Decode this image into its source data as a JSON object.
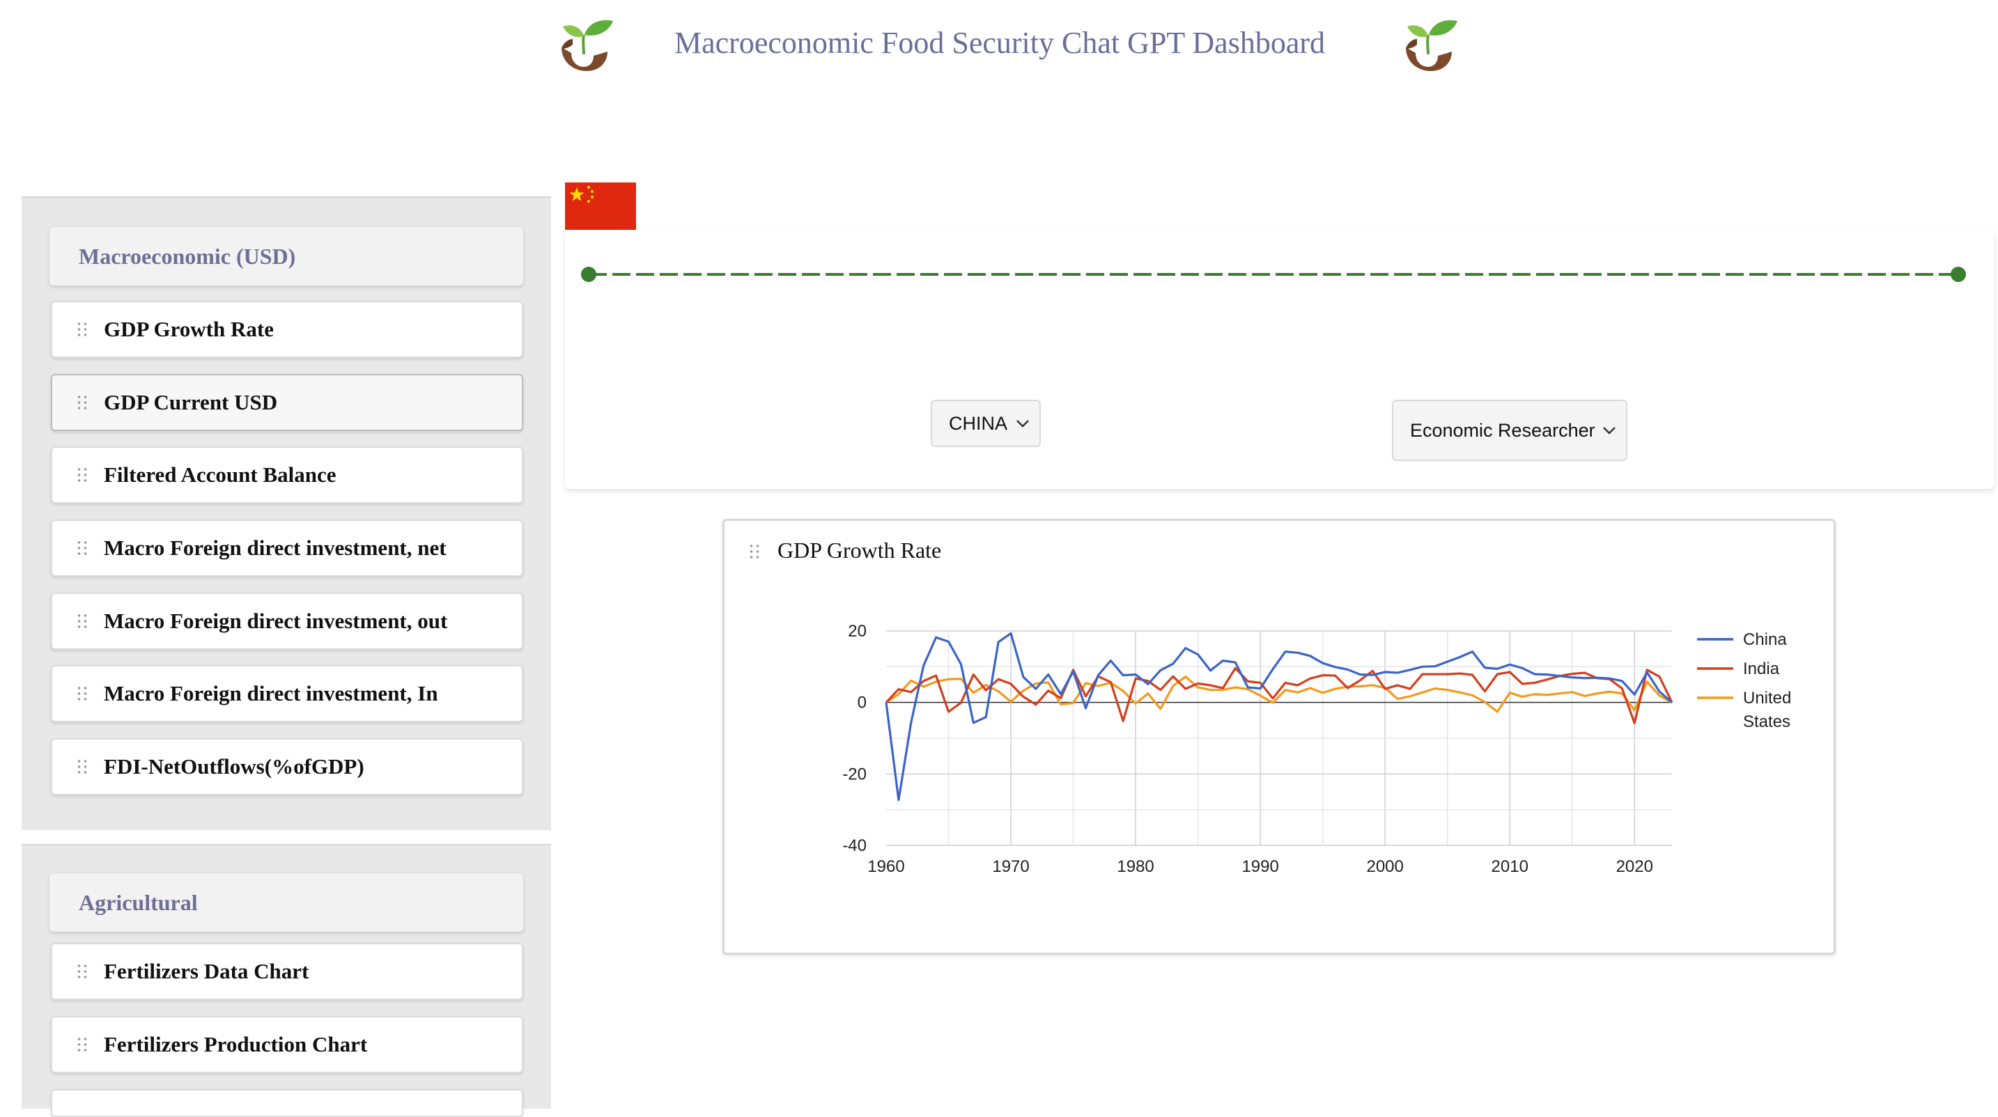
{
  "header": {
    "title": "Macroeconomic Food Security Chat GPT Dashboard",
    "logo_icon": "sprout-icon"
  },
  "sidebar": {
    "sections": [
      {
        "title": "Macroeconomic (USD)",
        "items": [
          {
            "label": "GDP Growth Rate"
          },
          {
            "label": "GDP Current USD",
            "active": true
          },
          {
            "label": "Filtered Account Balance"
          },
          {
            "label": "Macro Foreign direct investment, net"
          },
          {
            "label": "Macro Foreign direct investment, out"
          },
          {
            "label": "Macro Foreign direct investment, In"
          },
          {
            "label": "FDI-NetOutflows(%ofGDP)"
          }
        ]
      },
      {
        "title": "Agricultural",
        "items": [
          {
            "label": "Fertilizers Data Chart"
          },
          {
            "label": "Fertilizers Production Chart"
          }
        ]
      }
    ]
  },
  "controls": {
    "flag_icon": "china-flag-icon",
    "country_select": {
      "value": "CHINA"
    },
    "role_select": {
      "value": "Economic Researcher"
    },
    "timeline_color": "#3a7d2f"
  },
  "chart_card": {
    "title": "GDP Growth Rate"
  },
  "chart_data": {
    "type": "line",
    "title": "GDP Growth Rate",
    "xlabel": "",
    "ylabel": "",
    "xlim": [
      1960,
      2023
    ],
    "ylim": [
      -40,
      20
    ],
    "x_ticks": [
      1960,
      1970,
      1980,
      1990,
      2000,
      2010,
      2020
    ],
    "y_ticks": [
      20,
      0,
      -20,
      -40
    ],
    "grid": true,
    "legend": "right",
    "x": [
      1960,
      1961,
      1962,
      1963,
      1964,
      1965,
      1966,
      1967,
      1968,
      1969,
      1970,
      1971,
      1972,
      1973,
      1974,
      1975,
      1976,
      1977,
      1978,
      1979,
      1980,
      1981,
      1982,
      1983,
      1984,
      1985,
      1986,
      1987,
      1988,
      1989,
      1990,
      1991,
      1992,
      1993,
      1994,
      1995,
      1996,
      1997,
      1998,
      1999,
      2000,
      2001,
      2002,
      2003,
      2004,
      2005,
      2006,
      2007,
      2008,
      2009,
      2010,
      2011,
      2012,
      2013,
      2014,
      2015,
      2016,
      2017,
      2018,
      2019,
      2020,
      2021,
      2022,
      2023
    ],
    "series": [
      {
        "name": "China",
        "color": "#3b64c7",
        "values": [
          0,
          -27.3,
          -5.6,
          10.3,
          18.2,
          17,
          10.7,
          -5.7,
          -4.1,
          16.9,
          19.3,
          7.1,
          3.8,
          7.8,
          2.3,
          8.7,
          -1.6,
          7.6,
          11.7,
          7.6,
          7.8,
          5.1,
          9,
          10.8,
          15.2,
          13.4,
          8.9,
          11.7,
          11.2,
          4.2,
          3.9,
          9.3,
          14.2,
          13.9,
          13,
          11,
          9.9,
          9.2,
          7.8,
          7.7,
          8.5,
          8.3,
          9.1,
          10,
          10.1,
          11.4,
          12.7,
          14.2,
          9.7,
          9.4,
          10.6,
          9.6,
          7.9,
          7.8,
          7.4,
          7,
          6.8,
          6.9,
          6.7,
          6,
          2.2,
          8.4,
          3,
          0
        ]
      },
      {
        "name": "India",
        "color": "#d23f1f",
        "values": [
          0,
          3.7,
          2.9,
          6,
          7.5,
          -2.6,
          -0.1,
          7.8,
          3.4,
          6.5,
          5.2,
          1.6,
          -0.6,
          3.3,
          1.2,
          9.1,
          1.7,
          7.3,
          5.7,
          -5.2,
          6.7,
          6,
          3.5,
          7.3,
          3.8,
          5.3,
          4.8,
          4,
          9.6,
          5.9,
          5.5,
          1.1,
          5.5,
          4.8,
          6.7,
          7.6,
          7.5,
          4,
          6.2,
          8.8,
          3.8,
          4.8,
          3.8,
          7.9,
          7.9,
          7.9,
          8.1,
          7.7,
          3.1,
          7.9,
          8.5,
          5.2,
          5.5,
          6.4,
          7.4,
          8,
          8.3,
          6.8,
          6.5,
          3.9,
          -5.8,
          9.1,
          7.2,
          0
        ]
      },
      {
        "name": "United States",
        "color": "#f39a1c",
        "values": [
          0,
          2.3,
          6.1,
          4.4,
          5.8,
          6.5,
          6.6,
          2.7,
          4.9,
          3.1,
          0.2,
          3.3,
          5.3,
          5.6,
          -0.5,
          -0.2,
          5.4,
          4.6,
          5.5,
          3.2,
          -0.3,
          2.5,
          -1.8,
          4.6,
          7.2,
          4.2,
          3.5,
          3.5,
          4.2,
          3.7,
          1.9,
          -0.1,
          3.5,
          2.8,
          4,
          2.7,
          3.8,
          4.4,
          4.5,
          4.8,
          4.1,
          1,
          1.7,
          2.8,
          3.9,
          3.5,
          2.8,
          2,
          0.1,
          -2.6,
          2.7,
          1.6,
          2.3,
          2.1,
          2.5,
          2.9,
          1.8,
          2.5,
          3,
          2.5,
          -2.2,
          5.8,
          1.9,
          0
        ]
      }
    ]
  }
}
